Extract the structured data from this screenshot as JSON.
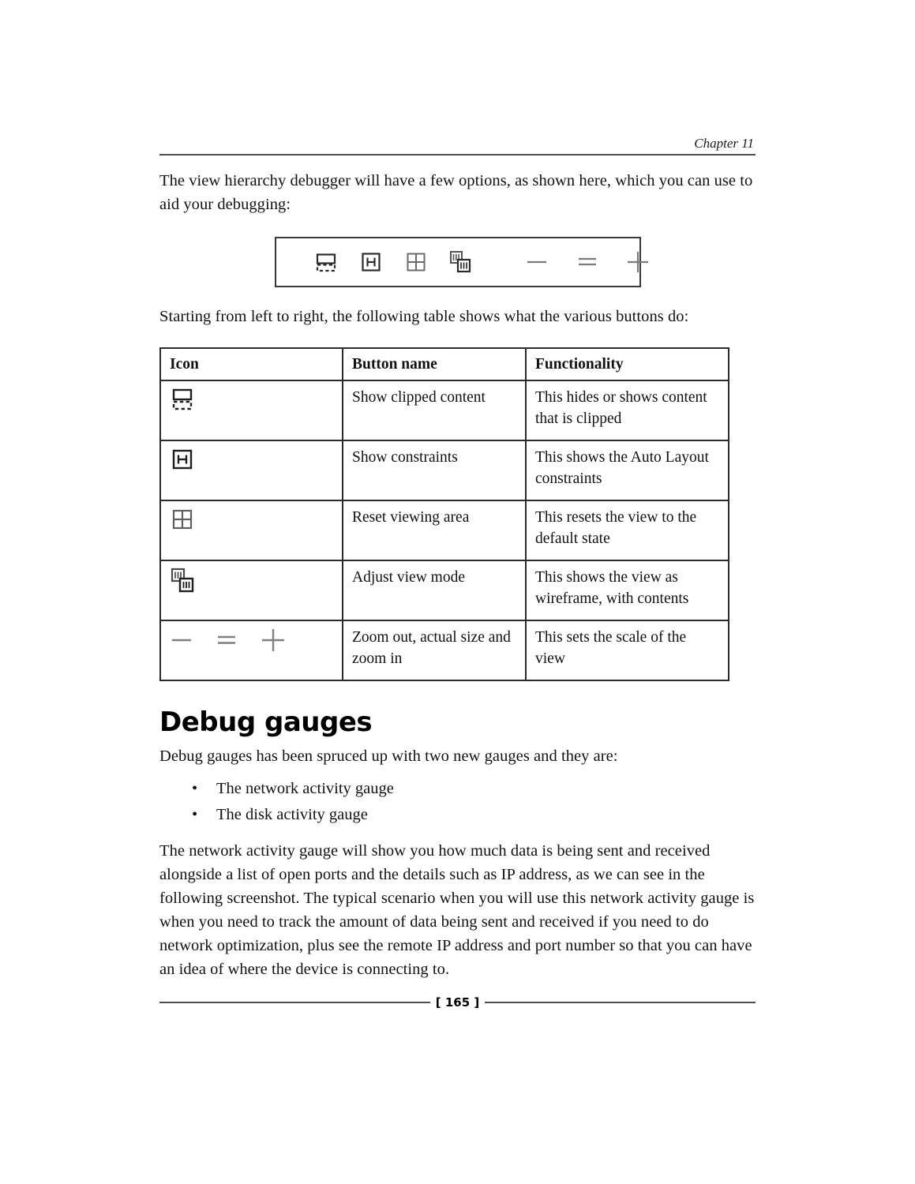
{
  "header": {
    "chapter_label": "Chapter 11"
  },
  "intro": {
    "paragraph": "The view hierarchy debugger will have a few options, as shown here, which you can use to aid your debugging:"
  },
  "toolbar_figure": {
    "icons": [
      {
        "name": "show-clipped-content-icon",
        "glyph": "clipped-rect"
      },
      {
        "name": "show-constraints-icon",
        "glyph": "h-in-square"
      },
      {
        "name": "reset-viewing-area-icon",
        "glyph": "four-pane-grid"
      },
      {
        "name": "adjust-view-mode-icon",
        "glyph": "wireframe-stack"
      },
      {
        "name": "zoom-out-icon",
        "glyph": "minus"
      },
      {
        "name": "actual-size-icon",
        "glyph": "equals"
      },
      {
        "name": "zoom-in-icon",
        "glyph": "plus"
      }
    ],
    "icon_color": "#6b6b6b",
    "border_color": "#3a3a3a"
  },
  "table_intro": {
    "paragraph": "Starting from left to right, the following table shows what the various buttons do:"
  },
  "buttons_table": {
    "headers": [
      "Icon",
      "Button name",
      "Functionality"
    ],
    "rows": [
      {
        "icon_glyphs": [
          "clipped-rect"
        ],
        "icon_name": "show-clipped-content-icon",
        "button_name": "Show clipped content",
        "functionality": "This hides or shows content that is clipped"
      },
      {
        "icon_glyphs": [
          "h-in-square"
        ],
        "icon_name": "show-constraints-icon",
        "button_name": "Show constraints",
        "functionality": "This shows the Auto Layout constraints"
      },
      {
        "icon_glyphs": [
          "four-pane-grid"
        ],
        "icon_name": "reset-viewing-area-icon",
        "button_name": "Reset viewing area",
        "functionality": "This resets the view to the default state"
      },
      {
        "icon_glyphs": [
          "wireframe-stack"
        ],
        "icon_name": "adjust-view-mode-icon",
        "button_name": "Adjust view mode",
        "functionality": "This shows the view as wireframe, with contents"
      },
      {
        "icon_glyphs": [
          "minus",
          "equals",
          "plus"
        ],
        "icon_name": "zoom-controls-icon",
        "button_name": "Zoom out, actual size and zoom in",
        "functionality": "This sets the scale of the view"
      }
    ]
  },
  "debug_gauges": {
    "heading": "Debug gauges",
    "intro": "Debug gauges has been spruced up with two new gauges and they are:",
    "bullet_marker": "•",
    "bullets": [
      "The network activity gauge",
      "The disk activity gauge"
    ],
    "closing_paragraph": "The network activity gauge will show you how much data is being sent and received alongside a list of open ports and the details such as IP address, as we can see in the following screenshot. The typical scenario when you will use this network activity gauge is when you need to track the amount of data being sent and received if you need to do network optimization, plus see the remote IP address and port number so that you can have an idea of where the device is connecting to."
  },
  "footer": {
    "page_number": "[ 165 ]"
  }
}
